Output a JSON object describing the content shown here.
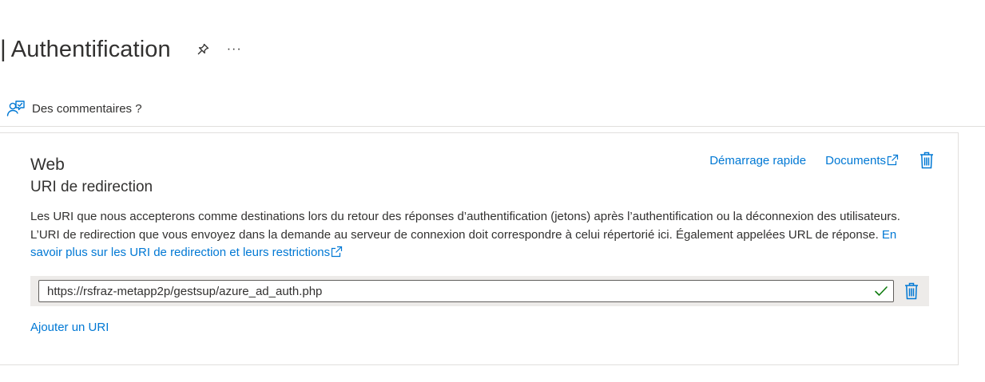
{
  "header": {
    "separator": "|",
    "title": "Authentification",
    "more_label": "···"
  },
  "feedback": {
    "label": "Des commentaires ?"
  },
  "card": {
    "platform": "Web",
    "section": "URI de redirection",
    "quickstart_link": "Démarrage rapide",
    "docs_link": "Documents",
    "description": "Les URI que nous accepterons comme destinations lors du retour des réponses d’authentification (jetons) après l’authentification ou la déconnexion des utilisateurs. L’URI de redirection que vous envoyez dans la demande au serveur de connexion doit correspondre à celui répertorié ici. Également appelées URL de réponse.",
    "learn_more_link": "En savoir plus sur les URI de redirection et leurs restrictions",
    "redirect_uris": [
      {
        "value": "https://rsfraz-metapp2p/gestsup/azure_ad_auth.php",
        "valid": true
      }
    ],
    "add_uri_link": "Ajouter un URI"
  },
  "colors": {
    "link": "#0078d4",
    "text": "#323130",
    "valid": "#107c10",
    "row_background": "#edebe9",
    "border": "#e1dfdd"
  },
  "icons": {
    "pin": "pin-icon",
    "feedback": "feedback-person-icon",
    "external": "external-link-icon",
    "delete": "trash-icon",
    "check": "checkmark-icon"
  }
}
